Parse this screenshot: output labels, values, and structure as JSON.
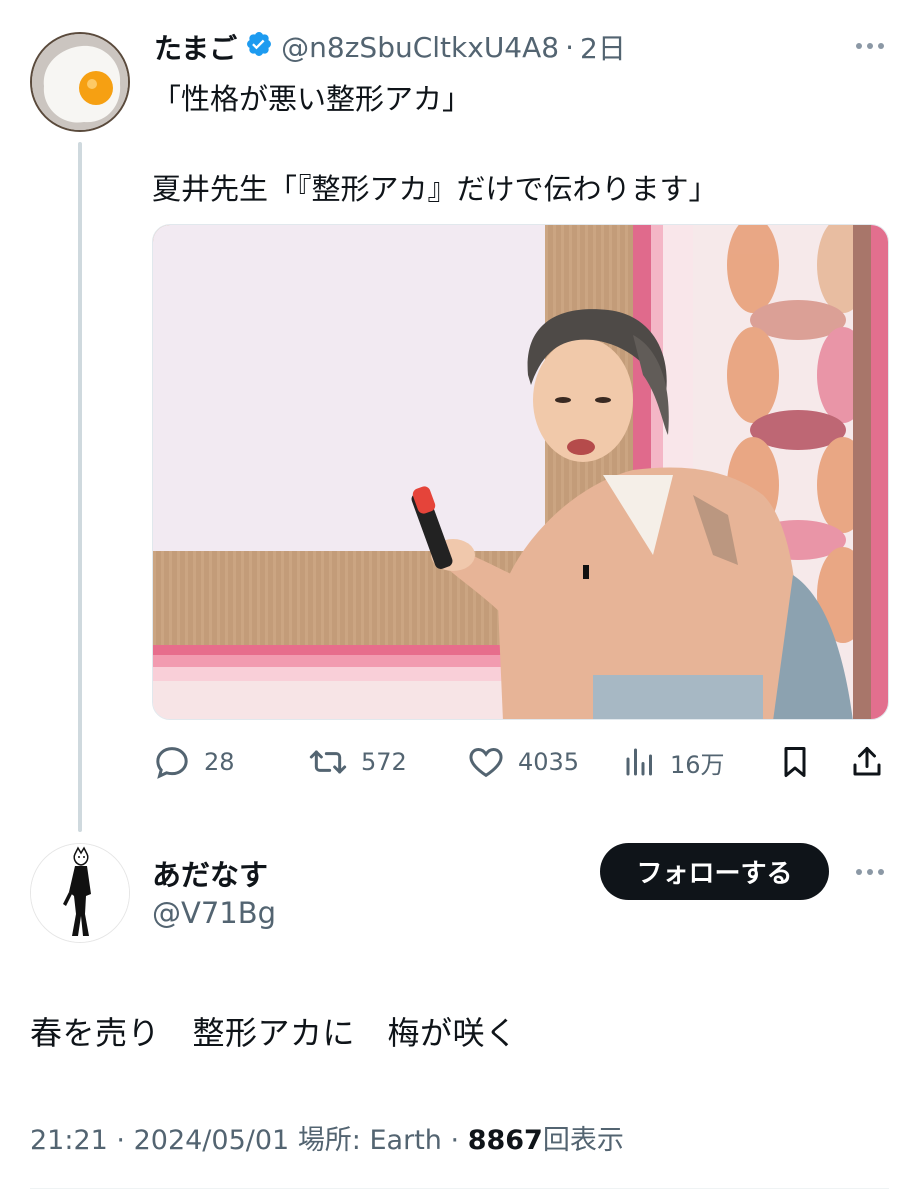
{
  "colors": {
    "accent_blue": "#1d9bf0",
    "text_primary": "#0f1419",
    "text_secondary": "#536471",
    "follow_button_bg": "#0f1419"
  },
  "original_tweet": {
    "display_name": "たまご",
    "handle": "@n8zSbuCltkxU4A8",
    "separator": "·",
    "time_ago": "2日",
    "verified": true,
    "text_line1": "「性格が悪い整形アカ」",
    "text_line2": "夏井先生「『整形アカ』だけで伝わります」",
    "actions": {
      "reply_count": "28",
      "retweet_count": "572",
      "like_count": "4035",
      "views_count": "16万"
    },
    "icons": [
      "reply-icon",
      "retweet-icon",
      "like-icon",
      "views-icon",
      "bookmark-icon",
      "share-icon"
    ]
  },
  "reply_tweet": {
    "display_name": "あだなす",
    "handle": "@V71Bg",
    "follow_label": "フォローする",
    "text": "春を売り　整形アカに　梅が咲く",
    "meta": {
      "time": "21:21",
      "sep1": "·",
      "date": "2024/05/01",
      "location": "場所: Earth",
      "sep2": "·",
      "views": "8867",
      "views_suffix": "回表示"
    }
  }
}
